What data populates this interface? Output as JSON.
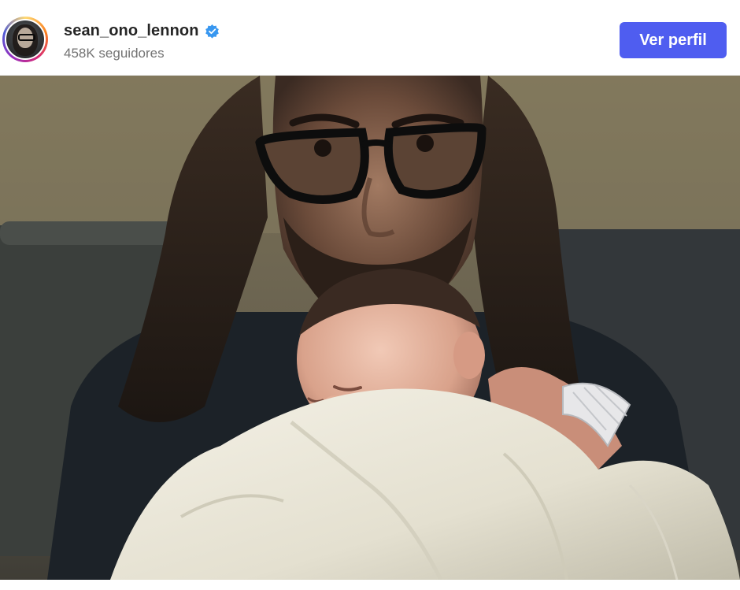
{
  "post": {
    "username": "sean_ono_lennon",
    "followers": "458K seguidores",
    "view_profile_label": "Ver perfil",
    "verified": true,
    "avatar_icon": "profile-avatar",
    "verified_icon": "verified-badge-icon"
  },
  "colors": {
    "button": "#4f5df0",
    "verified": "#3897f0",
    "username": "#262626",
    "followers": "#737373"
  }
}
